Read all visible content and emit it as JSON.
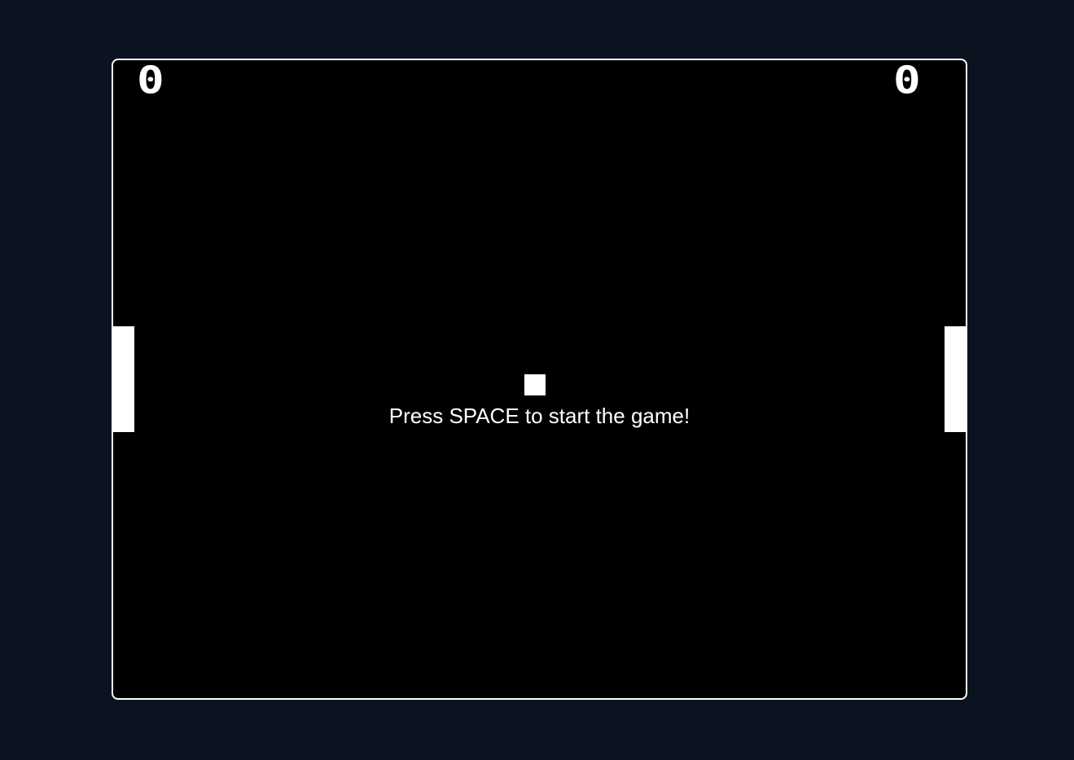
{
  "game": {
    "title": "",
    "background_color": "#0c1320",
    "field_color": "#000000",
    "foreground_color": "#ffffff",
    "scores": {
      "left_player": "0",
      "right_player": "0"
    },
    "message": "Press SPACE to start the game!",
    "state": "waiting-to-start"
  }
}
